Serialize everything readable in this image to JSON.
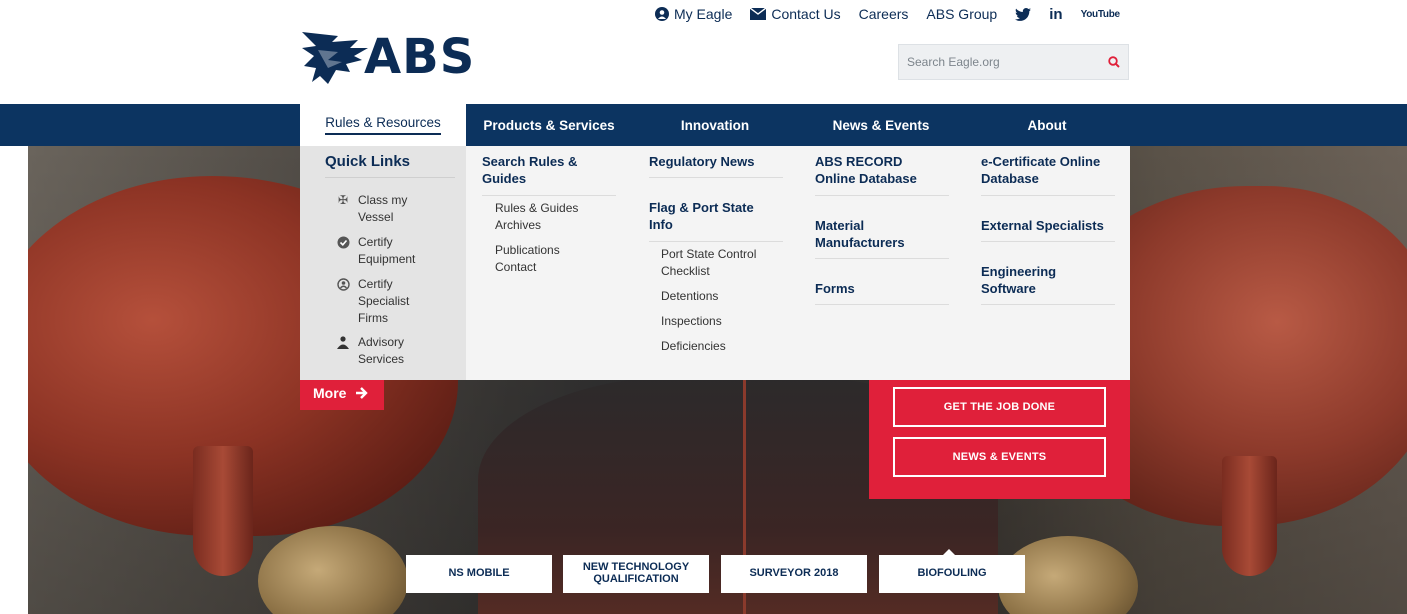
{
  "header": {
    "logo_text": "ABS",
    "toplinks": {
      "my_eagle": "My Eagle",
      "contact_us": "Contact Us",
      "careers": "Careers",
      "abs_group": "ABS Group",
      "linkedin": "in",
      "youtube": "YouTube"
    },
    "search": {
      "placeholder": "Search Eagle.org"
    }
  },
  "nav": {
    "items": [
      {
        "label": "Rules & Resources"
      },
      {
        "label": "Products & Services"
      },
      {
        "label": "Innovation"
      },
      {
        "label": "News & Events"
      },
      {
        "label": "About"
      }
    ]
  },
  "mega": {
    "quick_links": {
      "title": "Quick Links",
      "items": [
        {
          "label": "Class my Vessel",
          "icon": "ship-wheel-icon"
        },
        {
          "label": "Certify Equipment",
          "icon": "badge-check-icon"
        },
        {
          "label": "Certify Specialist Firms",
          "icon": "specialist-icon"
        },
        {
          "label": "Advisory Services",
          "icon": "people-icon"
        }
      ]
    },
    "col1": {
      "head": "Search Rules & Guides",
      "subs": [
        "Rules & Guides Archives",
        "Publications Contact"
      ]
    },
    "col2": {
      "head1": "Regulatory News",
      "head2": "Flag & Port State Info",
      "subs": [
        "Port State Control Checklist",
        "Detentions",
        "Inspections",
        "Deficiencies"
      ]
    },
    "col3": {
      "items": [
        "ABS RECORD Online Database",
        "Material Manufacturers",
        "Forms"
      ]
    },
    "col4": {
      "items": [
        "e-Certificate Online Database",
        "External Specialists",
        "Engineering Software"
      ]
    }
  },
  "hero": {
    "more_label": "More",
    "red_buttons": [
      "GET THE JOB DONE",
      "NEWS & EVENTS"
    ],
    "tabs": [
      "NS MOBILE",
      "NEW TECHNOLOGY QUALIFICATION",
      "SURVEYOR 2018",
      "BIOFOULING"
    ]
  },
  "colors": {
    "brand_navy": "#0c3461",
    "accent_red": "#e0203a"
  }
}
